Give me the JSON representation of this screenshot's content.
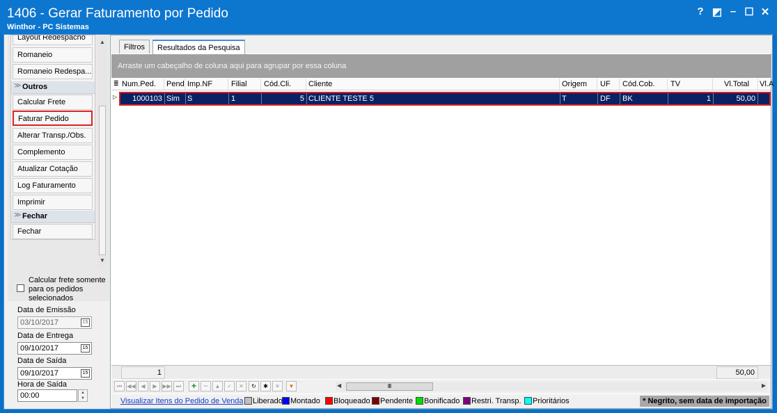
{
  "window": {
    "title": "1406 - Gerar Faturamento por Pedido",
    "subtitle": "Winthor - PC Sistemas",
    "controls": {
      "help": "?",
      "restore": "◩",
      "minimize": "–",
      "maximize": "☐",
      "close": "✕"
    }
  },
  "sidebar": {
    "items_top": [
      "Layout Redespacho",
      "Romaneio",
      "Romaneio Redespa..."
    ],
    "group_outros": "Outros",
    "items_outros": [
      "Calcular Frete",
      "Faturar Pedido",
      "Alterar Transp./Obs.",
      "Complemento",
      "Atualizar Cotação",
      "Log Faturamento",
      "Imprimir"
    ],
    "group_fechar": "Fechar",
    "items_fechar": [
      "Fechar"
    ],
    "highlighted_item": "Faturar Pedido"
  },
  "options": {
    "calc_frete_label": "Calcular frete somente para os pedidos selecionados",
    "calc_frete_checked": false,
    "data_emissao_label": "Data de Emissão",
    "data_emissao_value": "03/10/2017",
    "data_entrega_label": "Data de Entrega",
    "data_entrega_value": "09/10/2017",
    "data_saida_label": "Data de Saída",
    "data_saida_value": "09/10/2017",
    "hora_saida_label": "Hora de Saída",
    "hora_saida_value": "00:00",
    "calendar_icon_text": "15"
  },
  "tabs": [
    "Filtros",
    "Resultados da Pesquisa"
  ],
  "active_tab": "Resultados da Pesquisa",
  "grid": {
    "group_hint": "Arraste um cabeçalho de coluna aqui para agrupar por essa coluna",
    "columns": [
      "Num.Ped.",
      "Pend",
      "Imp.NF",
      "Filial",
      "Cód.Cli.",
      "Cliente",
      "Origem",
      "UF",
      "Cód.Cob.",
      "TV",
      "Vl.Total",
      "Vl.A"
    ],
    "rows": [
      [
        "1000103",
        "Sim",
        "S",
        "1",
        "5",
        "CLIENTE TESTE 5",
        "T",
        "DF",
        "BK",
        "1",
        "50,00",
        ""
      ]
    ],
    "footer_count": "1",
    "footer_total": "50,00"
  },
  "legend": {
    "link": "Visualizar Itens do Pedido de Venda",
    "items": [
      {
        "label": "Liberado",
        "color": "#c0c0c0"
      },
      {
        "label": "Montado",
        "color": "#0000ff"
      },
      {
        "label": "Bloqueado",
        "color": "#ff0000"
      },
      {
        "label": "Pendente",
        "color": "#800000"
      },
      {
        "label": "Bonificado",
        "color": "#00e000"
      },
      {
        "label": "Restri. Transp.",
        "color": "#800080"
      },
      {
        "label": "Prioritários",
        "color": "#00ffff"
      }
    ],
    "note": "* Negrito, sem data de importação"
  },
  "colors": {
    "titlebar": "#0d76cf",
    "selected_row": "#0a2263",
    "highlight_border": "#e02020"
  }
}
